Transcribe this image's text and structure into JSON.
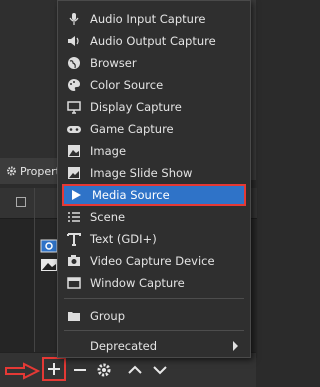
{
  "window": {
    "properties_label": "Propert"
  },
  "menu": {
    "items": [
      {
        "label": "Audio Input Capture",
        "icon": "microphone-icon"
      },
      {
        "label": "Audio Output Capture",
        "icon": "speaker-icon"
      },
      {
        "label": "Browser",
        "icon": "globe-icon"
      },
      {
        "label": "Color Source",
        "icon": "palette-icon"
      },
      {
        "label": "Display Capture",
        "icon": "monitor-icon"
      },
      {
        "label": "Game Capture",
        "icon": "gamepad-icon"
      },
      {
        "label": "Image",
        "icon": "image-icon"
      },
      {
        "label": "Image Slide Show",
        "icon": "slideshow-icon"
      },
      {
        "label": "Media Source",
        "icon": "play-icon",
        "selected": true
      },
      {
        "label": "Scene",
        "icon": "list-icon"
      },
      {
        "label": "Text (GDI+)",
        "icon": "text-icon"
      },
      {
        "label": "Video Capture Device",
        "icon": "camera-icon"
      },
      {
        "label": "Window Capture",
        "icon": "window-icon"
      }
    ],
    "group_label": "Group",
    "deprecated_label": "Deprecated"
  },
  "toolbar": {
    "add": "add-icon",
    "remove": "minus-icon",
    "settings": "gear-icon",
    "move_up": "chevron-up-icon",
    "move_down": "chevron-down-icon"
  },
  "colors": {
    "highlight": "#2f73c8",
    "annotation": "#e53935"
  }
}
